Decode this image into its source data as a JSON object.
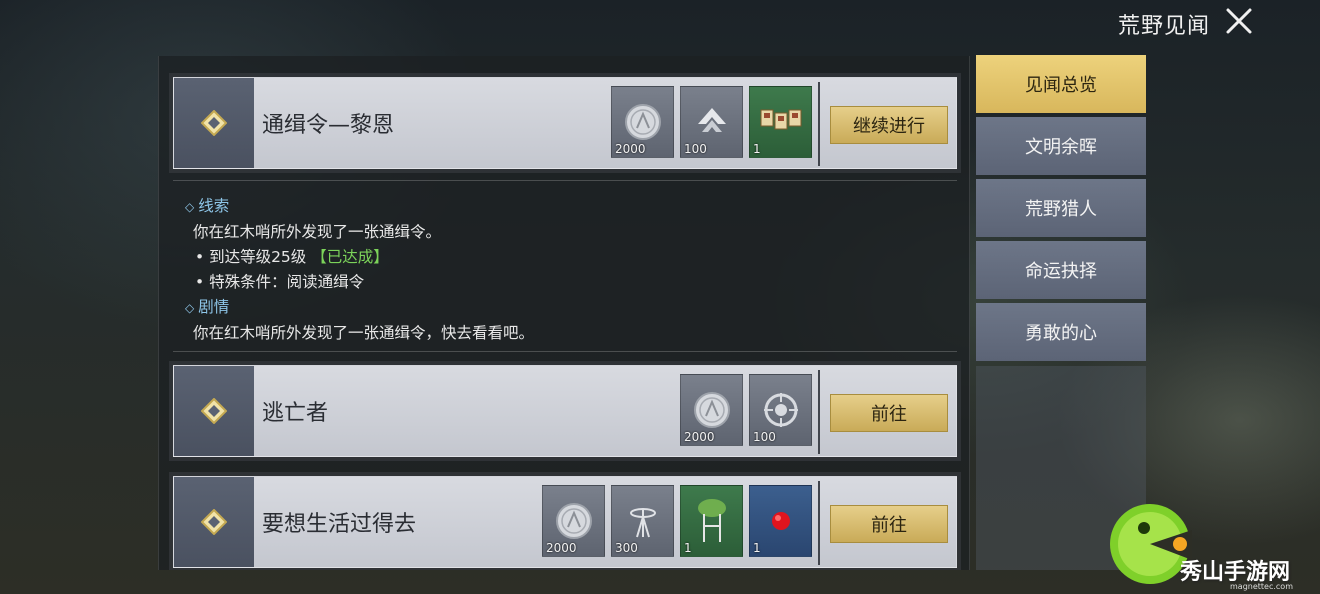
{
  "header": {
    "title": "荒野见闻"
  },
  "quests": [
    {
      "name": "通缉令—黎恩",
      "action_label": "继续进行",
      "rewards": [
        {
          "icon": "silver-coin-icon",
          "count": "2000"
        },
        {
          "icon": "experience-arrow-icon",
          "count": "100"
        },
        {
          "icon": "wanted-posters-icon",
          "count": "1"
        }
      ]
    },
    {
      "name": "逃亡者",
      "action_label": "前往",
      "rewards": [
        {
          "icon": "silver-coin-icon",
          "count": "2000"
        },
        {
          "icon": "emblem-badge-icon",
          "count": "100"
        }
      ]
    },
    {
      "name": "要想生活过得去",
      "action_label": "前往",
      "rewards": [
        {
          "icon": "silver-coin-icon",
          "count": "2000"
        },
        {
          "icon": "radio-tower-icon",
          "count": "300"
        },
        {
          "icon": "plant-stand-icon",
          "count": "1"
        },
        {
          "icon": "red-ball-icon",
          "count": "1"
        }
      ]
    }
  ],
  "detail": {
    "clue_title": "线索",
    "clue_text": "你在红木哨所外发现了一张通缉令。",
    "condition1": "• 到达等级25级",
    "condition1_status": "【已达成】",
    "condition2": "• 特殊条件：阅读通缉令",
    "story_title": "剧情",
    "story_text": "你在红木哨所外发现了一张通缉令，快去看看吧。"
  },
  "tabs": [
    "见闻总览",
    "文明余晖",
    "荒野猎人",
    "命运抉择",
    "勇敢的心"
  ],
  "active_tab": 0,
  "colors": {
    "accent_gold": "#d8b75c",
    "clue_blue": "#8ec6e8",
    "achieved_green": "#7cd35a"
  },
  "watermark": {
    "text": "秀山手游网",
    "sub": "magnettec.com"
  }
}
